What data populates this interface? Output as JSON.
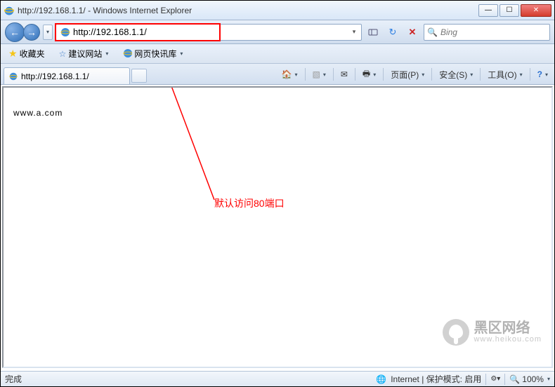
{
  "window": {
    "title": "http://192.168.1.1/ - Windows Internet Explorer"
  },
  "address": {
    "url": "http://192.168.1.1/",
    "search_engine": "Bing",
    "search_placeholder": "Bing"
  },
  "favorites": {
    "label": "收藏夹",
    "suggested": "建议网站",
    "slice": "网页快讯库"
  },
  "tabs": [
    {
      "title": "http://192.168.1.1/"
    }
  ],
  "commands": {
    "home": "主页",
    "feeds": "源",
    "mail": "阅读邮件",
    "print": "打印",
    "page": "页面(P)",
    "safety": "安全(S)",
    "tools": "工具(O)",
    "help": "帮助"
  },
  "page_body": {
    "heading": "www.a.com"
  },
  "annotation": {
    "text": "默认访问80端口"
  },
  "status": {
    "done": "完成",
    "zone": "Internet | 保护模式: 启用",
    "zoom": "100%"
  },
  "watermark": {
    "cn": "黑区网络",
    "en": "www.heikou.com"
  }
}
